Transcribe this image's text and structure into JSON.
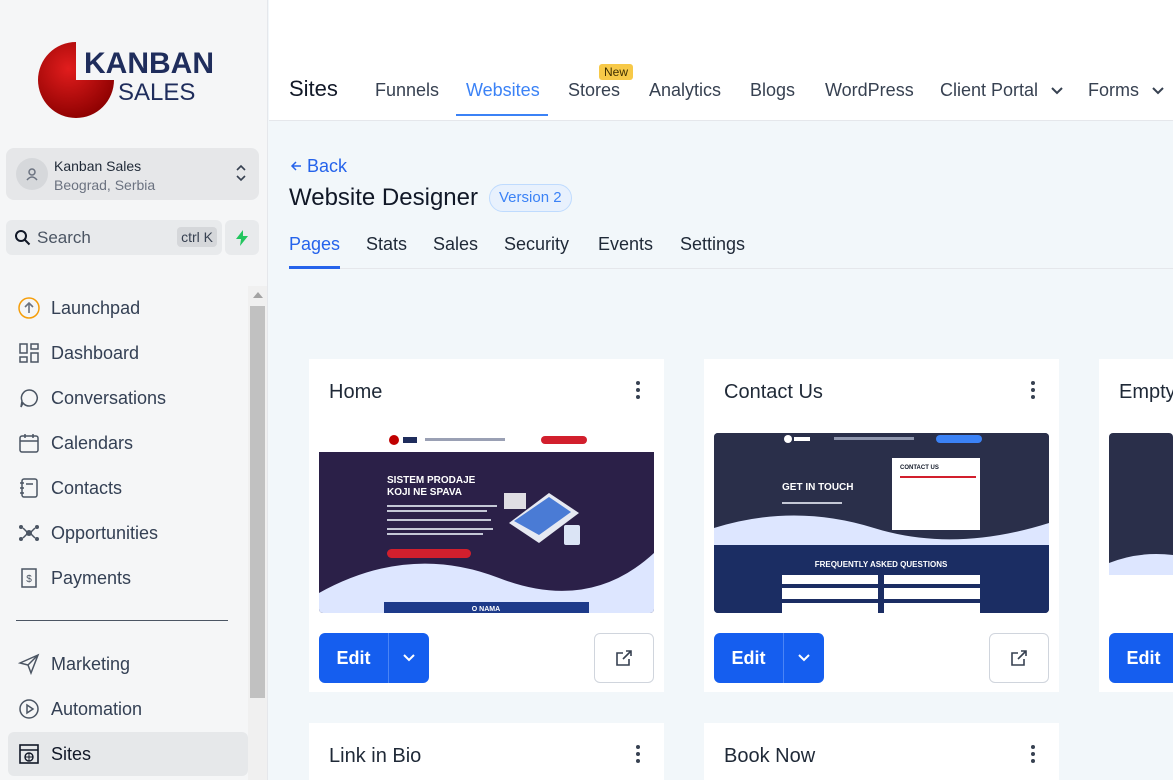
{
  "logo": {
    "line1": "KANBAN",
    "line2": "SALES"
  },
  "location": {
    "name": "Kanban Sales",
    "address": "Beograd, Serbia"
  },
  "search": {
    "placeholder": "Search",
    "shortcut": "ctrl K"
  },
  "sidebar": {
    "items": [
      {
        "label": "Launchpad",
        "icon": "launchpad-icon"
      },
      {
        "label": "Dashboard",
        "icon": "dashboard-icon"
      },
      {
        "label": "Conversations",
        "icon": "chat-icon"
      },
      {
        "label": "Calendars",
        "icon": "calendar-icon"
      },
      {
        "label": "Contacts",
        "icon": "contacts-icon"
      },
      {
        "label": "Opportunities",
        "icon": "opportunities-icon"
      },
      {
        "label": "Payments",
        "icon": "payments-icon"
      },
      {
        "label": "Marketing",
        "icon": "send-icon"
      },
      {
        "label": "Automation",
        "icon": "automation-icon"
      },
      {
        "label": "Sites",
        "icon": "sites-icon",
        "active": true
      }
    ]
  },
  "topbar": {
    "title": "Sites",
    "tabs": [
      "Funnels",
      "Websites",
      "Stores",
      "Analytics",
      "Blogs",
      "WordPress",
      "Client Portal",
      "Forms"
    ],
    "active_tab": "Websites",
    "new_badge": "New"
  },
  "content": {
    "back_label": "Back",
    "page_title": "Website Designer",
    "version": "Version 2",
    "sub_tabs": [
      "Pages",
      "Stats",
      "Sales",
      "Security",
      "Events",
      "Settings"
    ],
    "active_sub_tab": "Pages"
  },
  "cards": [
    {
      "title": "Home",
      "edit_label": "Edit",
      "thumb": {
        "hero1": "SISTEM PRODAJE",
        "hero2": "KOJI NE SPAVA",
        "footer": "O NAMA"
      }
    },
    {
      "title": "Contact Us",
      "edit_label": "Edit",
      "thumb": {
        "hero1": "GET IN TOUCH",
        "box": "CONTACT US",
        "faq": "FREQUENTLY ASKED QUESTIONS"
      }
    },
    {
      "title": "Empty",
      "edit_label": "Edit"
    },
    {
      "title": "Link in Bio"
    },
    {
      "title": "Book Now"
    }
  ],
  "colors": {
    "accent": "#155eef",
    "link": "#2563eb",
    "logo_red": "#c00000",
    "logo_navy": "#1f2d5c",
    "badge": "#f7c948"
  }
}
